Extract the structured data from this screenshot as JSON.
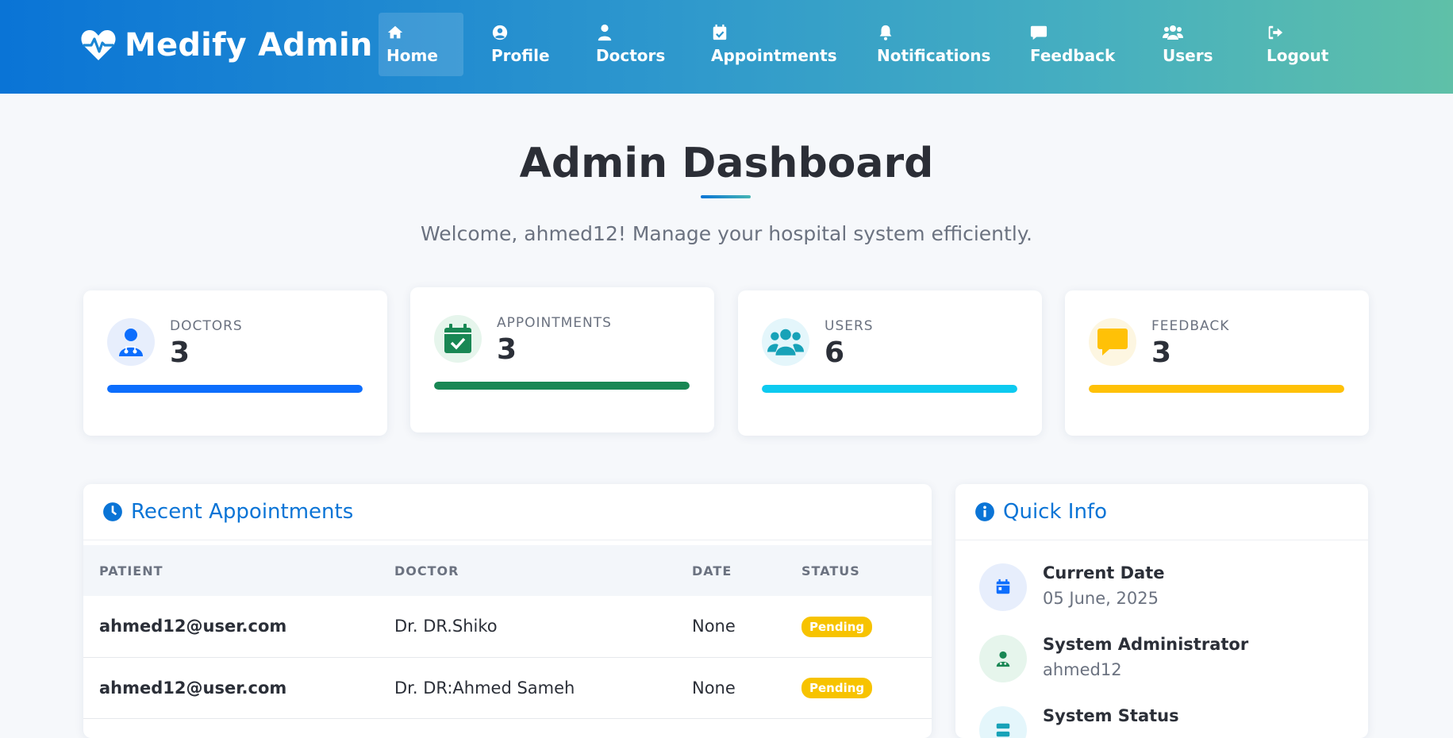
{
  "brand": {
    "name": "Medify Admin"
  },
  "nav": {
    "items": [
      {
        "label": "Home",
        "icon": "home-icon"
      },
      {
        "label": "Profile",
        "icon": "user-circle-icon"
      },
      {
        "label": "Doctors",
        "icon": "doctor-icon"
      },
      {
        "label": "Appointments",
        "icon": "calendar-check-icon"
      },
      {
        "label": "Notifications",
        "icon": "bell-icon"
      },
      {
        "label": "Feedback",
        "icon": "comment-icon"
      },
      {
        "label": "Users",
        "icon": "users-icon"
      },
      {
        "label": "Logout",
        "icon": "logout-icon"
      }
    ],
    "active": "Home"
  },
  "header": {
    "title": "Admin Dashboard",
    "welcome": "Welcome, ahmed12! Manage your hospital system efficiently."
  },
  "stats": [
    {
      "label": "DOCTORS",
      "value": "3",
      "icon": "doctor-icon",
      "color": "#0d6efd",
      "bg": "#e7eefc",
      "fill": 1.0
    },
    {
      "label": "APPOINTMENTS",
      "value": "3",
      "icon": "calendar-check-icon",
      "color": "#198754",
      "bg": "#e6f5ec",
      "fill": 1.0
    },
    {
      "label": "USERS",
      "value": "6",
      "icon": "users-icon",
      "color": "#0dcaf0",
      "bg": "#e4f6fb",
      "fill": 1.0
    },
    {
      "label": "FEEDBACK",
      "value": "3",
      "icon": "comment-icon",
      "color": "#ffc107",
      "bg": "#fdf6e1",
      "fill": 1.0
    }
  ],
  "appointments": {
    "title": "Recent Appointments",
    "columns": [
      "PATIENT",
      "DOCTOR",
      "DATE",
      "STATUS"
    ],
    "rows": [
      {
        "patient": "ahmed12@user.com",
        "doctor": "Dr. DR.Shiko",
        "date": "None",
        "status": "Pending"
      },
      {
        "patient": "ahmed12@user.com",
        "doctor": "Dr. DR:Ahmed Sameh",
        "date": "None",
        "status": "Pending"
      }
    ]
  },
  "quick_info": {
    "title": "Quick Info",
    "items": [
      {
        "title": "Current Date",
        "sub": "05 June, 2025",
        "icon": "calendar-icon",
        "color": "#0d6efd",
        "bg": "#e7eefc"
      },
      {
        "title": "System Administrator",
        "sub": "ahmed12",
        "icon": "user-doctor-icon",
        "color": "#198754",
        "bg": "#e6f5ec"
      },
      {
        "title": "System Status",
        "sub": "",
        "icon": "server-icon",
        "color": "#0dcaf0",
        "bg": "#e4f6fb"
      }
    ]
  },
  "colors": {
    "primary": "#0a74d6",
    "pending": "#f7c300"
  }
}
